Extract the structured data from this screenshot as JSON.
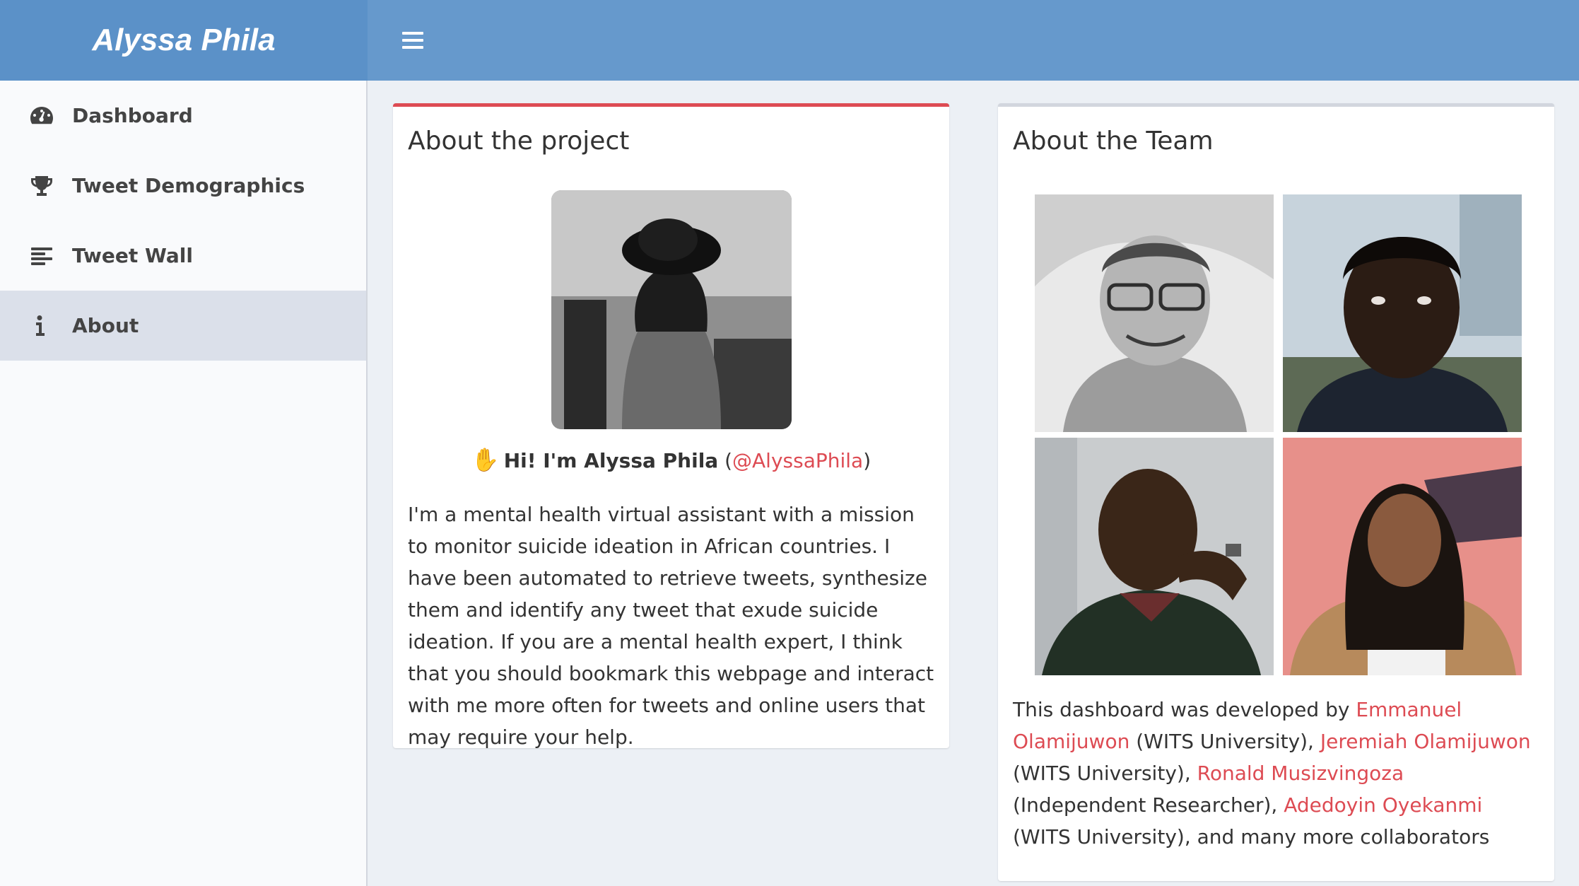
{
  "app": {
    "brand": "Alyssa Phila"
  },
  "header": {
    "menu_icon": "hamburger-icon"
  },
  "sidebar": {
    "items": [
      {
        "label": "Dashboard",
        "icon": "speedometer-icon",
        "active": false
      },
      {
        "label": "Tweet Demographics",
        "icon": "trophy-icon",
        "active": false
      },
      {
        "label": "Tweet Wall",
        "icon": "align-left-icon",
        "active": false
      },
      {
        "label": "About",
        "icon": "info-icon",
        "active": true
      }
    ]
  },
  "project": {
    "title": "About the project",
    "greeting_bold": "Hi! I'm Alyssa Phila",
    "greeting_open": " (",
    "handle": "@AlyssaPhila",
    "greeting_close": ")",
    "greeting_icon": "waving-hand-icon",
    "intro": "I'm a mental health virtual assistant with a mission to monitor suicide ideation in African countries. I have been automated to retrieve tweets, synthesize them and identify any tweet that exude suicide ideation. If you are a mental health expert, I think that you should bookmark this webpage and interact with me more often for tweets and online users that may require your help."
  },
  "team": {
    "title": "About the Team",
    "credits_prefix": "This dashboard was developed by ",
    "members": [
      {
        "name": "Emmanuel Olamijuwon",
        "affiliation": " (WITS University), "
      },
      {
        "name": "Jeremiah Olamijuwon",
        "affiliation": " (WITS University), "
      },
      {
        "name": "Ronald Musizvingoza",
        "affiliation": " (Independent Researcher), "
      },
      {
        "name": "Adedoyin Oyekanmi",
        "affiliation": " (WITS University), and many more collaborators"
      }
    ]
  },
  "colors": {
    "header": "#6699cc",
    "accent_link": "#dd4b53",
    "sidebar_active": "#dbe0ea"
  }
}
